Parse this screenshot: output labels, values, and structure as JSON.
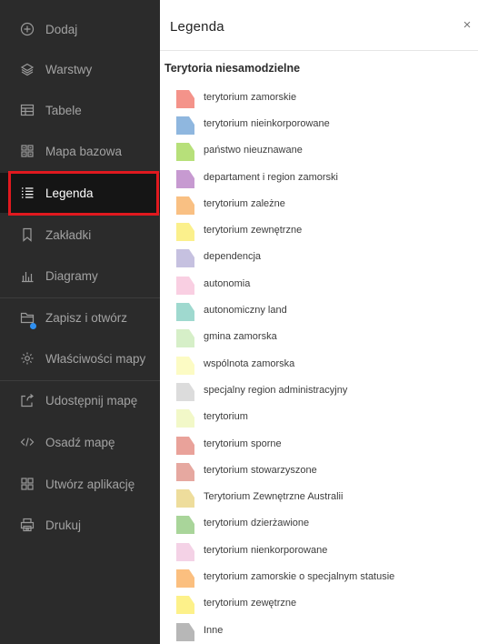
{
  "sidebar": {
    "items": [
      {
        "label": "Dodaj",
        "icon": "plus-circle-icon"
      },
      {
        "label": "Warstwy",
        "icon": "layers-icon"
      },
      {
        "label": "Tabele",
        "icon": "table-icon"
      },
      {
        "label": "Mapa bazowa",
        "icon": "basemap-grid-icon"
      },
      {
        "label": "Legenda",
        "icon": "legend-list-icon",
        "active": true
      },
      {
        "label": "Zakładki",
        "icon": "bookmark-icon"
      },
      {
        "label": "Diagramy",
        "icon": "bar-chart-icon"
      },
      {
        "label": "Zapisz i otwórz",
        "icon": "folder-icon"
      },
      {
        "label": "Właściwości mapy",
        "icon": "gear-icon"
      },
      {
        "label": "Udostępnij mapę",
        "icon": "share-icon"
      },
      {
        "label": "Osadź mapę",
        "icon": "code-icon"
      },
      {
        "label": "Utwórz aplikację",
        "icon": "apps-icon"
      },
      {
        "label": "Drukuj",
        "icon": "printer-icon"
      }
    ],
    "accent_color": "#e0191f",
    "status_dot_color": "#2f8ff0"
  },
  "panel": {
    "title": "Legenda",
    "close_glyph": "×",
    "section_title": "Terytoria niesamodzielne",
    "legend": [
      {
        "label": "terytorium zamorskie",
        "color": "#f4938a"
      },
      {
        "label": "terytorium nieinkorporowane",
        "color": "#8fb7df"
      },
      {
        "label": "państwo nieuznawane",
        "color": "#b7e07a"
      },
      {
        "label": "departament i region zamorski",
        "color": "#c79ad1"
      },
      {
        "label": "terytorium zależne",
        "color": "#f9c083"
      },
      {
        "label": "terytorium zewnętrzne",
        "color": "#fbf08c"
      },
      {
        "label": "dependencja",
        "color": "#c6c1e0"
      },
      {
        "label": "autonomia",
        "color": "#f9cfe2"
      },
      {
        "label": "autonomiczny land",
        "color": "#9fd9cf"
      },
      {
        "label": "gmina zamorska",
        "color": "#d6efc8"
      },
      {
        "label": "wspólnota zamorska",
        "color": "#fcfbc4"
      },
      {
        "label": "specjalny region administracyjny",
        "color": "#dcdcdc"
      },
      {
        "label": "terytorium",
        "color": "#f2f8c8"
      },
      {
        "label": "terytorium sporne",
        "color": "#e9a29a"
      },
      {
        "label": "terytorium stowarzyszone",
        "color": "#e6a8a0"
      },
      {
        "label": "Terytorium Zewnętrzne Australii",
        "color": "#eedd9c"
      },
      {
        "label": "terytorium dzierżawione",
        "color": "#a9d59a"
      },
      {
        "label": "terytorium nienkorporowane",
        "color": "#f4d2e6"
      },
      {
        "label": "terytorium zamorskie o specjalnym statusie",
        "color": "#fbbf7f"
      },
      {
        "label": "terytorium zewętrzne",
        "color": "#fdf18a"
      },
      {
        "label": "Inne",
        "color": "#b7b7b7"
      }
    ]
  }
}
